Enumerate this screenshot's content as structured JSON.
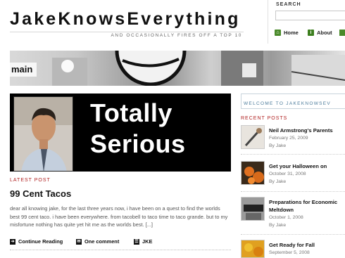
{
  "header": {
    "site_title": "JakeKnowsEverything",
    "tagline": "AND OCCASIONALLY FIRES OFF A TOP 10",
    "search_label": "SEARCH",
    "nav": [
      {
        "label": "Home",
        "icon": "home-icon"
      },
      {
        "label": "About",
        "icon": "info-icon"
      }
    ]
  },
  "banner": {
    "label": "main"
  },
  "hero": {
    "line1": "Totally",
    "line2": "Serious"
  },
  "latest_post": {
    "section_label": "LATEST POST",
    "title": "99 Cent Tacos",
    "excerpt": "dear all knowing jake, for the last three years now, i have been on a quest to find the worlds best 99 cent taco. i have been everywhere. from tacobell to taco time to taco grande. but to my misfortune nothing has quite yet hit me as the worlds best. [...]",
    "continue_label": "Continue Reading",
    "comments_label": "One comment",
    "author_label": "JKE"
  },
  "sidebar": {
    "welcome_text": "WELCOME TO JAKEKNOWSEV",
    "recent_label": "RECENT POSTS",
    "recent_posts": [
      {
        "title": "Neil Armstrong's Parents",
        "date": "February 25, 2009",
        "author": "By Jake"
      },
      {
        "title": "Get your Halloween on",
        "date": "October 31, 2008",
        "author": "By Jake"
      },
      {
        "title": "Preparations for Economic Meltdown",
        "date": "October 1, 2008",
        "author": "By Jake"
      },
      {
        "title": "Get Ready for Fall",
        "date": "September 5, 2008",
        "author": ""
      }
    ]
  },
  "colors": {
    "accent_red": "#b02020",
    "nav_green": "#4a8a2a",
    "link_blue": "#4a7a9a"
  }
}
